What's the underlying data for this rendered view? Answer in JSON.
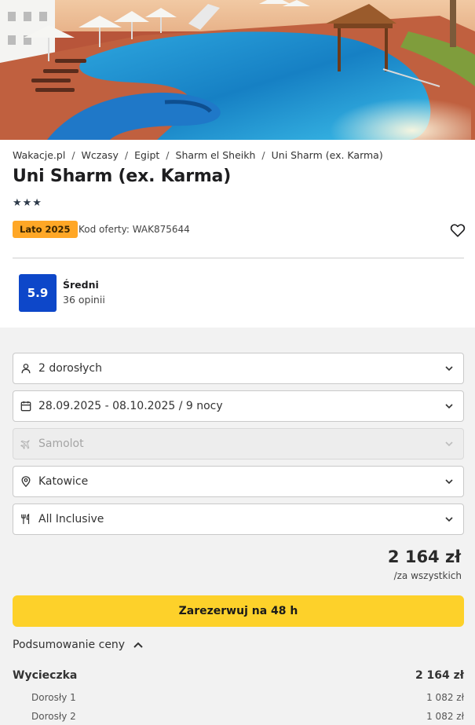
{
  "breadcrumbs": [
    "Wakacje.pl",
    "Wczasy",
    "Egipt",
    "Sharm el Sheikh",
    "Uni Sharm (ex. Karma)"
  ],
  "hotel": {
    "name": "Uni Sharm (ex. Karma)",
    "stars_text": "★★★",
    "star_count": 3,
    "season_badge": "Lato 2025",
    "offer_code": "Kod oferty: WAK875644"
  },
  "rating": {
    "score": "5.9",
    "label": "Średni",
    "count": "36 opinii"
  },
  "filters": {
    "travelers": "2 dorosłych",
    "dates": "28.09.2025 - 08.10.2025 / 9 nocy",
    "transport": "Samolot",
    "departure": "Katowice",
    "board": "All Inclusive"
  },
  "price": {
    "amount": "2 164 zł",
    "note": "/za wszystkich"
  },
  "book_button": "Zarezerwuj na 48 h",
  "summary": {
    "toggle_label": "Podsumowanie ceny",
    "trip_label": "Wycieczka",
    "trip_total": "2 164 zł",
    "items": [
      {
        "label": "Dorosły 1",
        "price": "1 082 zł"
      },
      {
        "label": "Dorosły 2",
        "price": "1 082 zł"
      }
    ]
  },
  "colors": {
    "accent_yellow": "#fdd12a",
    "badge_orange": "#ffa726",
    "score_blue": "#0d47c9"
  }
}
